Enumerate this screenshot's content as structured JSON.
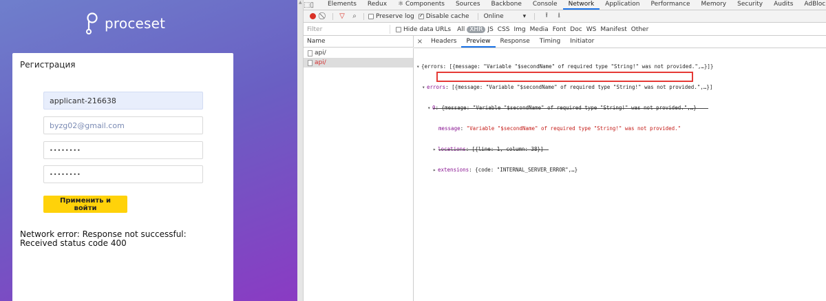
{
  "app": {
    "brand": "proceset",
    "card_title": "Регистрация",
    "fields": {
      "login_value": "applicant-216638",
      "email_placeholder": "byzg02@gmail.com",
      "password_value": "••••••••",
      "password_confirm_value": "••••••••"
    },
    "submit_label": "Применить и войти",
    "error_text": "Network error: Response not successful: Received status code 400",
    "colors": {
      "button": "#ffd20a",
      "gradient_top": "#6f7fcc",
      "gradient_bottom": "#8a3bc3"
    }
  },
  "devtools": {
    "tabs": [
      "Elements",
      "Redux",
      "⚛ Components",
      "Sources",
      "Backbone",
      "Console",
      "Network",
      "Application",
      "Performance",
      "Memory",
      "Security",
      "Audits",
      "AdBlock"
    ],
    "active_tab": "Network",
    "more_icon": "»",
    "toolbar": {
      "preserve_log": "Preserve log",
      "disable_cache": "Disable cache",
      "throttle": "Online",
      "throttle_arrow": "▾"
    },
    "filter": {
      "placeholder": "Filter",
      "hide_data_urls": "Hide data URLs",
      "types": [
        "All",
        "XHR",
        "JS",
        "CSS",
        "Img",
        "Media",
        "Font",
        "Doc",
        "WS",
        "Manifest",
        "Other"
      ],
      "active_type": "XHR"
    },
    "requests": {
      "column_header": "Name",
      "items": [
        {
          "name": "api/",
          "error": false
        },
        {
          "name": "api/",
          "error": true
        }
      ]
    },
    "detail_tabs": [
      "Headers",
      "Preview",
      "Response",
      "Timing",
      "Initiator"
    ],
    "active_detail_tab": "Preview",
    "preview": {
      "line1": "{errors: [{message: \"Variable \"$secondName\" of required type \"String!\" was not provided.\",…}]}",
      "line2_key": "errors",
      "line2_rest": ": [{message: \"Variable \"$secondName\" of required type \"String!\" was not provided.\",…}]",
      "line3_key": "0",
      "line3_rest": ": {message: \"Variable \"$secondName\" of required type \"String!\" was not provided.\",…}",
      "line4_key": "message",
      "line4_value": "\"Variable \"$secondName\" of required type \"String!\" was not provided.\"",
      "line5_key": "locations",
      "line5_rest": ": [{line: 1, column: 38}]",
      "line6_key": "extensions",
      "line6_rest": ": {code: \"INTERNAL_SERVER_ERROR\",…}"
    }
  }
}
